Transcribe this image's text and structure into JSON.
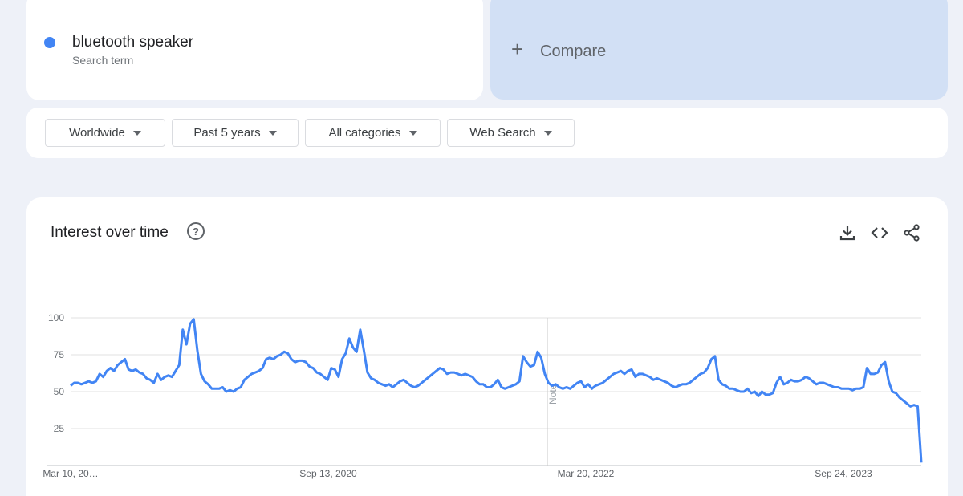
{
  "term": {
    "name": "bluetooth speaker",
    "sub": "Search term",
    "color": "#4285f4"
  },
  "compare": {
    "label": "Compare"
  },
  "filters": [
    {
      "label": "Worldwide"
    },
    {
      "label": "Past 5 years"
    },
    {
      "label": "All categories"
    },
    {
      "label": "Web Search"
    }
  ],
  "iot": {
    "title": "Interest over time",
    "help": "?"
  },
  "tools": {
    "download": "download-icon",
    "embed": "embed-icon",
    "share": "share-icon"
  },
  "chart_data": {
    "type": "line",
    "title": "Interest over time",
    "ylim": [
      0,
      100
    ],
    "y_ticks": [
      "25",
      "50",
      "75",
      "100"
    ],
    "x_tick_labels": [
      "Mar 10, 20…",
      "Sep 13, 2020",
      "Mar 20, 2022",
      "Sep 24, 2023"
    ],
    "note_label": "Note",
    "grid": true,
    "line_color": "#4285f4",
    "series": [
      {
        "values": [
          54,
          56,
          56,
          55,
          56,
          57,
          56,
          57,
          62,
          60,
          64,
          66,
          64,
          68,
          70,
          72,
          65,
          64,
          65,
          63,
          62,
          59,
          58,
          56,
          62,
          58,
          60,
          61,
          60,
          64,
          68,
          92,
          82,
          96,
          99,
          78,
          62,
          57,
          55,
          52,
          52,
          52,
          53,
          50,
          51,
          50,
          52,
          53,
          58,
          60,
          62,
          63,
          64,
          66,
          72,
          73,
          72,
          74,
          75,
          77,
          76,
          72,
          70,
          71,
          71,
          70,
          67,
          66,
          63,
          62,
          60,
          58,
          66,
          65,
          60,
          72,
          76,
          86,
          80,
          77,
          92,
          78,
          63,
          59,
          58,
          56,
          55,
          54,
          55,
          53,
          55,
          57,
          58,
          56,
          54,
          53,
          54,
          56,
          58,
          60,
          62,
          64,
          66,
          65,
          62,
          63,
          63,
          62,
          61,
          62,
          61,
          60,
          57,
          55,
          55,
          53,
          53,
          55,
          58,
          53,
          52,
          53,
          54,
          55,
          57,
          74,
          70,
          67,
          68,
          77,
          73,
          62,
          56,
          54,
          55,
          53,
          52,
          53,
          52,
          54,
          56,
          57,
          53,
          55,
          52,
          54,
          55,
          56,
          58,
          60,
          62,
          63,
          64,
          62,
          64,
          65,
          60,
          62,
          62,
          61,
          60,
          58,
          59,
          58,
          57,
          56,
          54,
          53,
          54,
          55,
          55,
          56,
          58,
          60,
          62,
          63,
          66,
          72,
          74,
          58,
          55,
          54,
          52,
          52,
          51,
          50,
          50,
          52,
          49,
          50,
          47,
          50,
          48,
          48,
          49,
          56,
          60,
          55,
          56,
          58,
          57,
          57,
          58,
          60,
          59,
          57,
          55,
          56,
          56,
          55,
          54,
          53,
          53,
          52,
          52,
          52,
          51,
          52,
          52,
          53,
          66,
          62,
          62,
          63,
          68,
          70,
          57,
          50,
          49,
          46,
          44,
          42,
          40,
          41,
          40,
          2
        ]
      }
    ]
  }
}
